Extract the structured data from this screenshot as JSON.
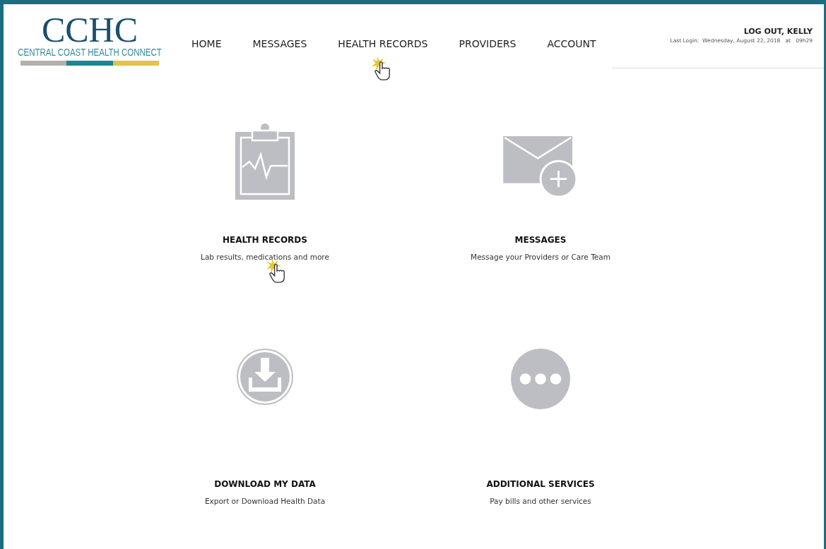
{
  "logo": {
    "mark": "CCHC",
    "name": "CENTRAL COAST HEALTH CONNECT"
  },
  "nav": [
    {
      "label": "HOME"
    },
    {
      "label": "MESSAGES"
    },
    {
      "label": "HEALTH RECORDS",
      "cursor": true
    },
    {
      "label": "PROVIDERS"
    },
    {
      "label": "ACCOUNT"
    }
  ],
  "account": {
    "logout": "LOG OUT, KELLY",
    "last_login": "Last Login:  Wednesday, August 22, 2018   at   09h29"
  },
  "tiles": [
    {
      "kind": "clipboard",
      "title": "HEALTH RECORDS",
      "subtitle": "Lab results, medications and more",
      "cursor": true
    },
    {
      "kind": "envelope",
      "title": "MESSAGES",
      "subtitle": "Message your Providers or Care Team",
      "cursor": false
    },
    {
      "kind": "download",
      "title": "DOWNLOAD MY DATA",
      "subtitle": "Export or Download Health Data",
      "cursor": false
    },
    {
      "kind": "more",
      "title": "ADDITIONAL SERVICES",
      "subtitle": "Pay bills and other services",
      "cursor": false
    }
  ]
}
